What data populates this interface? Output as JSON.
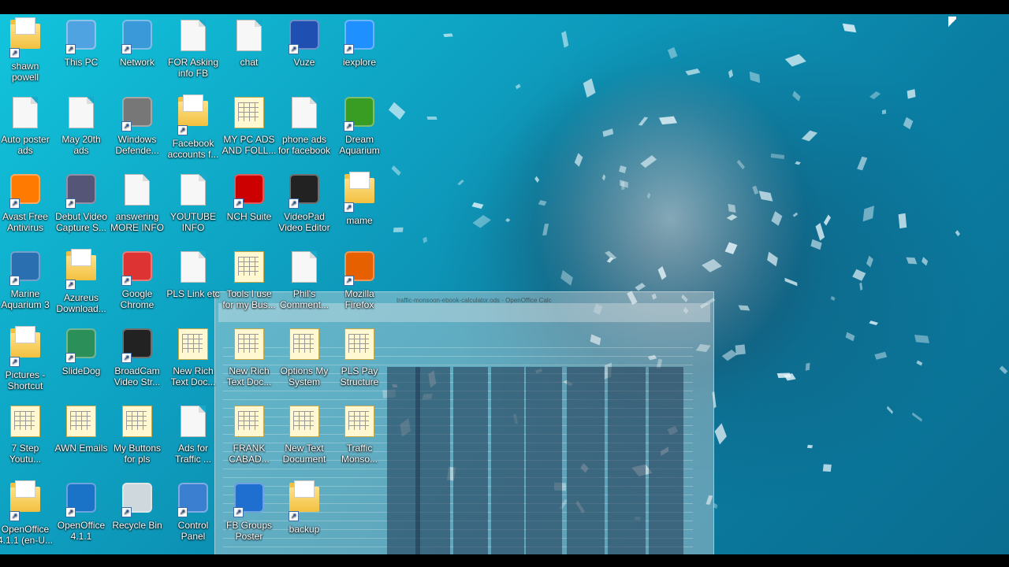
{
  "desktop": {
    "icons": [
      {
        "label": "shawn powell",
        "kind": "user-folder"
      },
      {
        "label": "Auto poster ads",
        "kind": "document"
      },
      {
        "label": "Avast Free Antivirus",
        "kind": "app-avast"
      },
      {
        "label": "Marine Aquarium 3",
        "kind": "app-fish"
      },
      {
        "label": "Pictures - Shortcut",
        "kind": "folder"
      },
      {
        "label": "7 Step Youtu...",
        "kind": "spreadsheet"
      },
      {
        "label": "OpenOffice 4.1.1 (en-U...",
        "kind": "folder"
      },
      {
        "label": "This PC",
        "kind": "computer"
      },
      {
        "label": "May 20th ads",
        "kind": "document"
      },
      {
        "label": "Debut Video Capture S...",
        "kind": "app-film"
      },
      {
        "label": "Azureus Download...",
        "kind": "folder"
      },
      {
        "label": "SlideDog",
        "kind": "app-dog"
      },
      {
        "label": "AWN Emails",
        "kind": "spreadsheet"
      },
      {
        "label": "OpenOffice 4.1.1",
        "kind": "app-openoffice"
      },
      {
        "label": "Network",
        "kind": "network"
      },
      {
        "label": "Windows Defende...",
        "kind": "app-wall"
      },
      {
        "label": "answering MORE INFO",
        "kind": "document"
      },
      {
        "label": "Google Chrome",
        "kind": "app-chrome"
      },
      {
        "label": "BroadCam Video Str...",
        "kind": "app-broadcam"
      },
      {
        "label": "My Buttons for pls",
        "kind": "spreadsheet"
      },
      {
        "label": "Recycle Bin",
        "kind": "recycle"
      },
      {
        "label": "FOR Asking info FB",
        "kind": "document"
      },
      {
        "label": "Facebook accounts f...",
        "kind": "folder"
      },
      {
        "label": "YOUTUBE INFO",
        "kind": "document"
      },
      {
        "label": "PLS Link etc",
        "kind": "document"
      },
      {
        "label": "New Rich Text Doc...",
        "kind": "spreadsheet"
      },
      {
        "label": "Ads for Traffic ...",
        "kind": "document"
      },
      {
        "label": "Control Panel",
        "kind": "control-panel"
      },
      {
        "label": "chat",
        "kind": "document"
      },
      {
        "label": "MY PC ADS AND FOLL...",
        "kind": "spreadsheet"
      },
      {
        "label": "NCH Suite",
        "kind": "app-nch"
      },
      {
        "label": "Tools I use for my Bus...",
        "kind": "spreadsheet"
      },
      {
        "label": "New Rich Text Doc...",
        "kind": "spreadsheet"
      },
      {
        "label": "FRANK CABAD...",
        "kind": "spreadsheet"
      },
      {
        "label": "FB Groups Poster",
        "kind": "app-shield"
      },
      {
        "label": "Vuze",
        "kind": "app-vuze"
      },
      {
        "label": "phone ads for facebook",
        "kind": "document"
      },
      {
        "label": "VideoPad Video Editor",
        "kind": "app-videopad"
      },
      {
        "label": "Phil's Comment...",
        "kind": "document"
      },
      {
        "label": "Options My System",
        "kind": "spreadsheet"
      },
      {
        "label": "New Text Document",
        "kind": "spreadsheet"
      },
      {
        "label": "backup",
        "kind": "folder"
      },
      {
        "label": "iexplore",
        "kind": "app-ie"
      },
      {
        "label": "Dream Aquarium",
        "kind": "app-grass"
      },
      {
        "label": "mame",
        "kind": "folder"
      },
      {
        "label": "Mozilla Firefox",
        "kind": "app-firefox"
      },
      {
        "label": "PLS Pay Structure",
        "kind": "spreadsheet"
      },
      {
        "label": "Traffic Monso...",
        "kind": "spreadsheet"
      }
    ]
  },
  "calc_window": {
    "title": "traffic-monsoon-ebook-calculator.ods - OpenOffice Calc"
  }
}
